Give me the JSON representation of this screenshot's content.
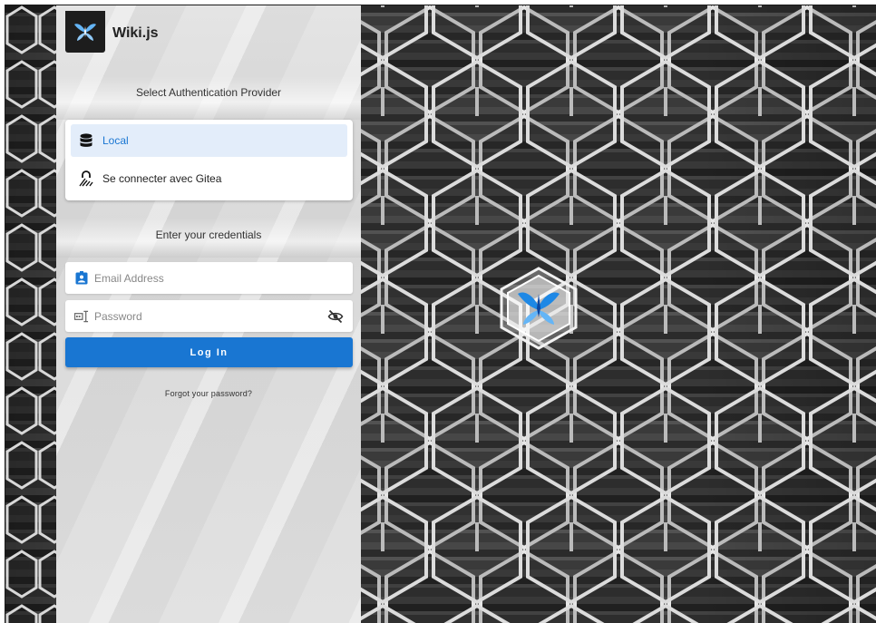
{
  "app": {
    "title": "Wiki.js"
  },
  "auth": {
    "select_title": "Select Authentication Provider",
    "providers": [
      {
        "label": "Local",
        "icon": "database-icon",
        "active": true
      },
      {
        "label": "Se connecter avec Gitea",
        "icon": "fingerprint-lock-icon",
        "active": false
      }
    ]
  },
  "credentials": {
    "title": "Enter your credentials",
    "email_placeholder": "Email Address",
    "password_placeholder": "Password",
    "login_label": "Log In",
    "forgot_label": "Forgot your password?"
  },
  "colors": {
    "accent": "#1976d2",
    "active_bg": "#e3edfa",
    "logo_bg": "#1d1d1d"
  },
  "icons": {
    "email": "contact-card-icon",
    "password": "form-textbox-password-icon",
    "toggle_visibility": "eye-off-icon"
  }
}
